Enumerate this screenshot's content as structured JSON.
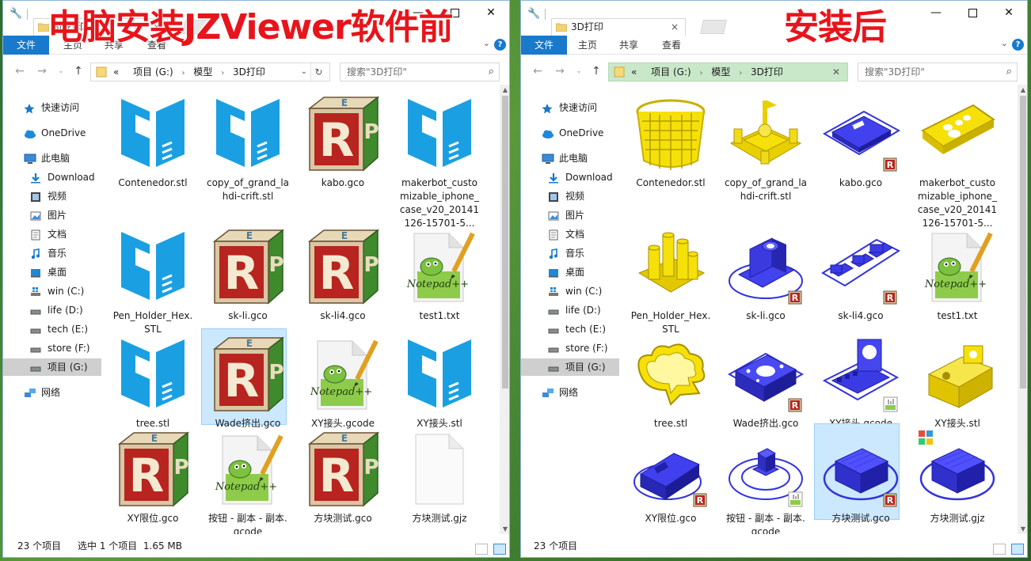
{
  "captions": {
    "before": "电脑安装JZViewer软件前",
    "after": "安装后"
  },
  "colors": {
    "accent": "#1979ca",
    "caption": "#e8141b",
    "stl_icon": "#1aa0e2",
    "preview_blue": "#3333dd",
    "preview_yellow": "#f5e00a"
  },
  "left": {
    "tab_title": "3D打印",
    "ribbon": {
      "file": "文件",
      "tabs": [
        "主页",
        "共享",
        "查看"
      ]
    },
    "address": {
      "overflow": "«",
      "crumbs": [
        "项目 (G:)",
        "模型",
        "3D打印"
      ]
    },
    "search_placeholder": "搜索\"3D打印\"",
    "nav": [
      {
        "label": "快速访问",
        "icon": "star-icon"
      },
      {
        "label": "OneDrive",
        "icon": "cloud-icon"
      },
      {
        "label": "此电脑",
        "icon": "computer-icon"
      },
      {
        "label": "Download",
        "icon": "download-icon"
      },
      {
        "label": "视频",
        "icon": "video-icon"
      },
      {
        "label": "图片",
        "icon": "pictures-icon"
      },
      {
        "label": "文档",
        "icon": "document-icon"
      },
      {
        "label": "音乐",
        "icon": "music-icon"
      },
      {
        "label": "桌面",
        "icon": "desktop-icon"
      },
      {
        "label": "win (C:)",
        "icon": "windows-drive-icon"
      },
      {
        "label": "life (D:)",
        "icon": "drive-icon"
      },
      {
        "label": "tech (E:)",
        "icon": "drive-icon"
      },
      {
        "label": "store (F:)",
        "icon": "drive-icon"
      },
      {
        "label": "项目 (G:)",
        "icon": "drive-icon",
        "selected": true
      },
      {
        "label": "网络",
        "icon": "network-icon"
      }
    ],
    "files": [
      {
        "name": "Contenedor.stl",
        "icon": "stl-file-icon"
      },
      {
        "name": "copy_of_grand_lahdi-crift.stl",
        "icon": "stl-file-icon"
      },
      {
        "name": "kabo.gco",
        "icon": "repetier-file-icon"
      },
      {
        "name": "makerbot_customizable_iphone_case_v20_20141126-15701-5...",
        "icon": "stl-file-icon"
      },
      {
        "name": "Pen_Holder_Hex.STL",
        "icon": "stl-file-icon"
      },
      {
        "name": "sk-li.gco",
        "icon": "repetier-file-icon"
      },
      {
        "name": "sk-li4.gco",
        "icon": "repetier-file-icon"
      },
      {
        "name": "test1.txt",
        "icon": "notepad-file-icon"
      },
      {
        "name": "tree.stl",
        "icon": "stl-file-icon"
      },
      {
        "name": "Wade挤出.gco",
        "icon": "repetier-file-icon",
        "selected": true
      },
      {
        "name": "XY接头.gcode",
        "icon": "notepad-file-icon"
      },
      {
        "name": "XY接头.stl",
        "icon": "stl-file-icon"
      },
      {
        "name": "XY限位.gco",
        "icon": "repetier-file-icon"
      },
      {
        "name": "按钮 - 副本 - 副本.gcode",
        "icon": "notepad-file-icon"
      },
      {
        "name": "方块测试.gco",
        "icon": "repetier-file-icon"
      },
      {
        "name": "方块测试.gjz",
        "icon": "blank-file-icon"
      }
    ],
    "status": {
      "count": "23 个项目",
      "selection": "选中 1 个项目  1.65 MB"
    }
  },
  "right": {
    "tab_title": "3D打印",
    "ribbon": {
      "file": "文件",
      "tabs": [
        "主页",
        "共享",
        "查看"
      ]
    },
    "address": {
      "overflow": "«",
      "crumbs": [
        "项目 (G:)",
        "模型",
        "3D打印"
      ]
    },
    "search_placeholder": "搜索\"3D打印\"",
    "nav": [
      {
        "label": "快速访问",
        "icon": "star-icon"
      },
      {
        "label": "OneDrive",
        "icon": "cloud-icon"
      },
      {
        "label": "此电脑",
        "icon": "computer-icon"
      },
      {
        "label": "Download",
        "icon": "download-icon"
      },
      {
        "label": "视频",
        "icon": "video-icon"
      },
      {
        "label": "图片",
        "icon": "pictures-icon"
      },
      {
        "label": "文档",
        "icon": "document-icon"
      },
      {
        "label": "音乐",
        "icon": "music-icon"
      },
      {
        "label": "桌面",
        "icon": "desktop-icon"
      },
      {
        "label": "win (C:)",
        "icon": "windows-drive-icon"
      },
      {
        "label": "life (D:)",
        "icon": "drive-icon"
      },
      {
        "label": "tech (E:)",
        "icon": "drive-icon"
      },
      {
        "label": "store (F:)",
        "icon": "drive-icon"
      },
      {
        "label": "项目 (G:)",
        "icon": "drive-icon",
        "selected": true
      },
      {
        "label": "网络",
        "icon": "network-icon"
      }
    ],
    "files": [
      {
        "name": "Contenedor.stl",
        "icon": "yellow-basket-preview-icon"
      },
      {
        "name": "copy_of_grand_lahdi-crift.stl",
        "icon": "yellow-castle-preview-icon"
      },
      {
        "name": "kabo.gco",
        "icon": "blue-plate-preview-icon"
      },
      {
        "name": "makerbot_customizable_iphone_case_v20_20141126-15701-5...",
        "icon": "yellow-phone-case-preview-icon"
      },
      {
        "name": "Pen_Holder_Hex.STL",
        "icon": "yellow-pen-holder-preview-icon"
      },
      {
        "name": "sk-li.gco",
        "icon": "blue-bracket-preview-icon"
      },
      {
        "name": "sk-li4.gco",
        "icon": "blue-parts-preview-icon"
      },
      {
        "name": "test1.txt",
        "icon": "notepad-file-icon"
      },
      {
        "name": "tree.stl",
        "icon": "yellow-tree-cutter-preview-icon"
      },
      {
        "name": "Wade挤出.gco",
        "icon": "blue-extruder-preview-icon"
      },
      {
        "name": "XY接头.gcode",
        "icon": "blue-joint-preview-icon"
      },
      {
        "name": "XY接头.stl",
        "icon": "yellow-joint-preview-icon"
      },
      {
        "name": "XY限位.gco",
        "icon": "blue-limit-preview-icon"
      },
      {
        "name": "按钮 - 副本 - 副本.gcode",
        "icon": "blue-button-preview-icon"
      },
      {
        "name": "方块测试.gco",
        "icon": "blue-cube-preview-icon",
        "selected": true
      },
      {
        "name": "方块测试.gjz",
        "icon": "blue-cube-preview-icon"
      }
    ],
    "status": {
      "count": "23 个项目"
    }
  }
}
